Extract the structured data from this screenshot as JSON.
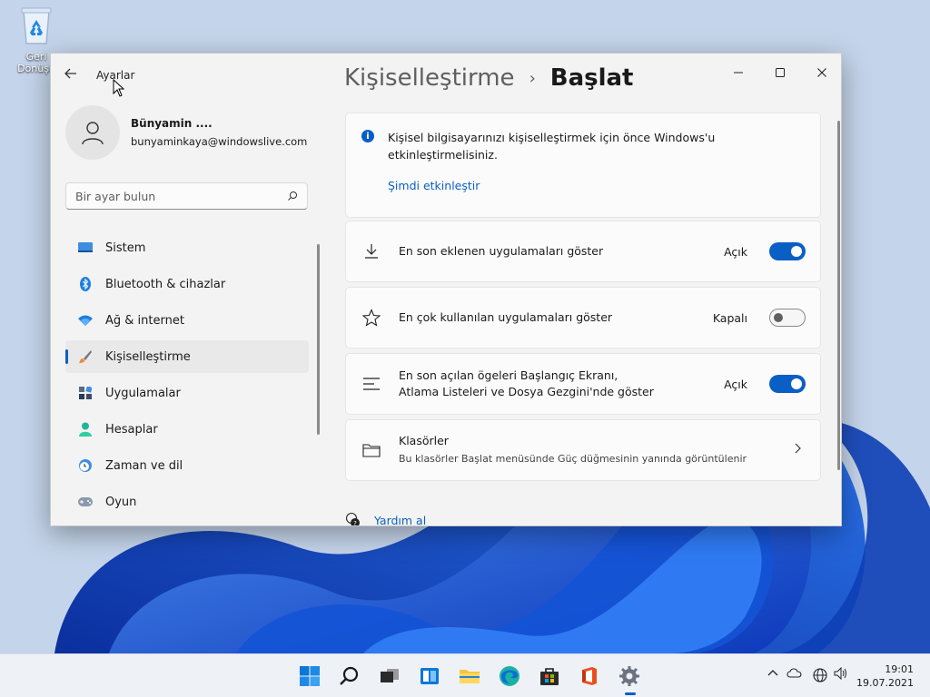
{
  "desktop": {
    "recycle_bin_label_1": "Geri",
    "recycle_bin_label_2": "Dönüşü"
  },
  "window": {
    "app_title": "Ayarlar",
    "controls": {
      "minimize": "—",
      "maximize": "☐",
      "close": "✕"
    }
  },
  "profile": {
    "name": "Bünyamin ....",
    "email": "bunyaminkaya@windowslive.com"
  },
  "search": {
    "placeholder": "Bir ayar bulun"
  },
  "sidebar": {
    "items": [
      {
        "label": "Sistem",
        "icon": "monitor-icon"
      },
      {
        "label": "Bluetooth & cihazlar",
        "icon": "bluetooth-icon"
      },
      {
        "label": "Ağ & internet",
        "icon": "wifi-icon"
      },
      {
        "label": "Kişiselleştirme",
        "icon": "brush-icon",
        "active": true
      },
      {
        "label": "Uygulamalar",
        "icon": "apps-icon"
      },
      {
        "label": "Hesaplar",
        "icon": "person-icon"
      },
      {
        "label": "Zaman ve dil",
        "icon": "globe-clock-icon"
      },
      {
        "label": "Oyun",
        "icon": "gamepad-icon"
      }
    ]
  },
  "breadcrumb": {
    "parent": "Kişiselleştirme",
    "separator": "›",
    "current": "Başlat"
  },
  "activation_notice": {
    "text": "Kişisel bilgisayarınızı kişiselleştirmek için önce Windows'u etkinleştirmelisiniz.",
    "link": "Şimdi etkinleştir"
  },
  "settings": [
    {
      "label": "En son eklenen uygulamaları göster",
      "state": "Açık",
      "on": true,
      "icon": "download-icon"
    },
    {
      "label": "En çok kullanılan uygulamaları göster",
      "state": "Kapalı",
      "on": false,
      "icon": "star-icon"
    },
    {
      "label_line1": "En son açılan ögeleri Başlangıç Ekranı,",
      "label_line2": "Atlama Listeleri ve Dosya Gezgini'nde göster",
      "state": "Açık",
      "on": true,
      "icon": "list-icon"
    }
  ],
  "folders": {
    "title": "Klasörler",
    "subtitle": "Bu klasörler Başlat menüsünde Güç düğmesinin yanında görüntülenir"
  },
  "help": {
    "link": "Yardım al"
  },
  "taskbar": {
    "time": "19:01",
    "date": "19.07.2021",
    "accent": "#0a5fc4"
  }
}
